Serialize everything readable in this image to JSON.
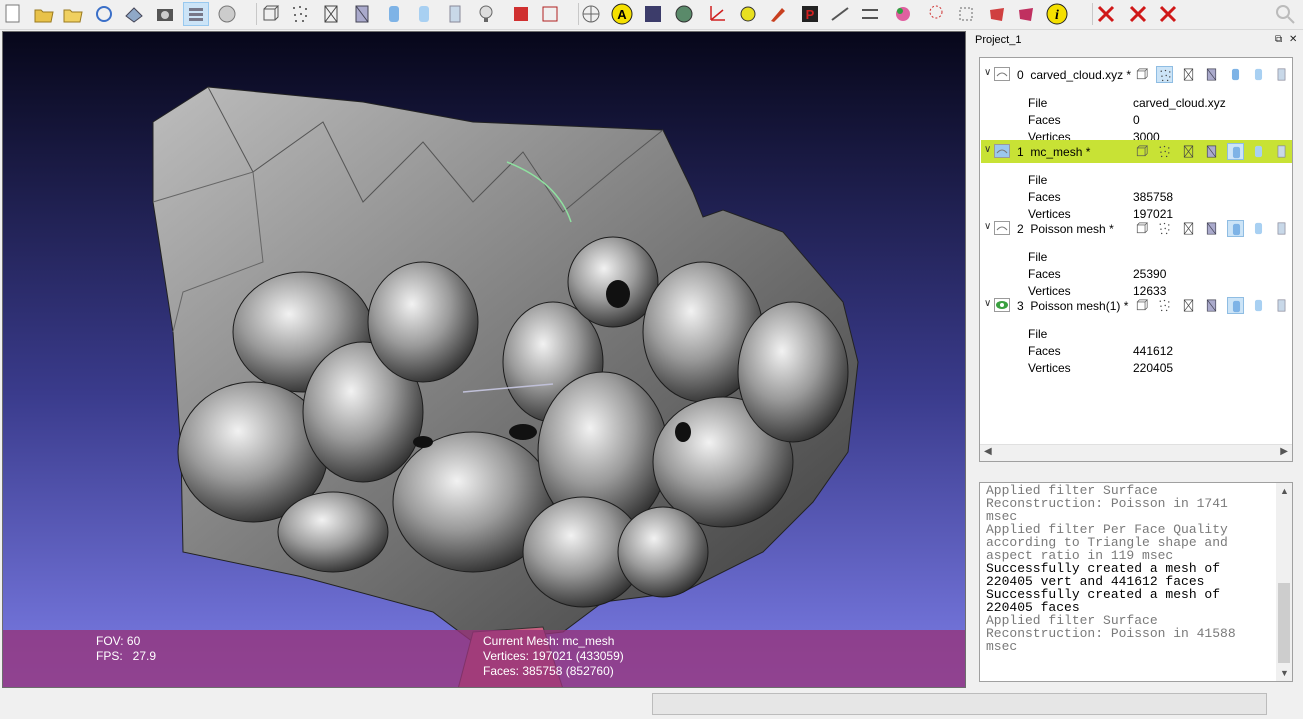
{
  "toolbar": {
    "buttons": [
      {
        "icon": "new-project-icon"
      },
      {
        "icon": "open-project-icon"
      },
      {
        "icon": "import-mesh-icon"
      },
      {
        "icon": "reload-icon"
      },
      {
        "icon": "save-snapshot-icon"
      },
      {
        "icon": "camera-icon"
      },
      {
        "icon": "layers-icon",
        "active": true
      },
      {
        "icon": "raster-layers-icon"
      },
      {
        "icon": "bounding-box-icon"
      },
      {
        "icon": "points-icon"
      },
      {
        "icon": "wireframe-icon"
      },
      {
        "icon": "hidden-lines-icon"
      },
      {
        "icon": "flat-shading-icon"
      },
      {
        "icon": "smooth-shading-icon"
      },
      {
        "icon": "texture-icon"
      },
      {
        "icon": "light-icon"
      },
      {
        "icon": "fancy-lighting-icon"
      },
      {
        "icon": "back-face-icon"
      },
      {
        "icon": "trackball-icon"
      },
      {
        "icon": "annotation-icon"
      },
      {
        "icon": "ambient-occlusion-icon"
      },
      {
        "icon": "sphere-render-icon"
      },
      {
        "icon": "axes-icon"
      },
      {
        "icon": "color-icon"
      },
      {
        "icon": "paint-brush-icon"
      },
      {
        "icon": "pick-points-icon"
      },
      {
        "icon": "measure-icon"
      },
      {
        "icon": "align-icon"
      },
      {
        "icon": "select-vertices-icon"
      },
      {
        "icon": "reference-icon"
      },
      {
        "icon": "select-faces-icon"
      },
      {
        "icon": "select-region-icon"
      },
      {
        "icon": "select-connected-icon"
      },
      {
        "icon": "info-icon"
      },
      {
        "icon": "delete-faces-icon"
      },
      {
        "icon": "delete-vertices-icon"
      },
      {
        "icon": "delete-all-icon"
      }
    ]
  },
  "viewport": {
    "fov_label": "FOV: 60",
    "fps_label": "FPS:   27.9",
    "current_mesh": "Current Mesh: mc_mesh",
    "vertices": "Vertices: 197021 (433059)",
    "faces": "Faces: 385758 (852760)"
  },
  "project": {
    "title": "Project_1",
    "layers": [
      {
        "index": "0",
        "name": "carved_cloud.xyz *",
        "file": "carved_cloud.xyz",
        "faces": "0",
        "vertices": "3000",
        "selected": false,
        "vis_icon": "layer-visible-icon"
      },
      {
        "index": "1",
        "name": "mc_mesh *",
        "file": "",
        "faces": "385758",
        "vertices": "197021",
        "selected": true,
        "vis_icon": "layer-visible-icon"
      },
      {
        "index": "2",
        "name": "Poisson mesh *",
        "file": "",
        "faces": "25390",
        "vertices": "12633",
        "selected": false,
        "vis_icon": "layer-visible-icon"
      },
      {
        "index": "3",
        "name": "Poisson mesh(1) *",
        "file": "",
        "faces": "441612",
        "vertices": "220405",
        "selected": false,
        "vis_icon": "eye-icon"
      }
    ],
    "labels": {
      "file": "File",
      "faces": "Faces",
      "vertices": "Vertices"
    }
  },
  "log": [
    {
      "text": "Applied filter Surface",
      "gray": true
    },
    {
      "text": "Reconstruction: Poisson in 1741",
      "gray": true
    },
    {
      "text": "msec",
      "gray": true
    },
    {
      "text": "Applied filter Per Face Quality",
      "gray": true
    },
    {
      "text": "according to Triangle shape and",
      "gray": true
    },
    {
      "text": "aspect ratio in 119 msec",
      "gray": true
    },
    {
      "text": "Successfully created a mesh of",
      "gray": false
    },
    {
      "text": "220405 vert and 441612 faces",
      "gray": false
    },
    {
      "text": "Successfully created a mesh of",
      "gray": false
    },
    {
      "text": "220405 faces",
      "gray": false
    },
    {
      "text": "Applied filter Surface",
      "gray": true
    },
    {
      "text": "Reconstruction: Poisson in 41588",
      "gray": true
    },
    {
      "text": "msec",
      "gray": true
    }
  ],
  "colors": {
    "viewport_top": "#07071a",
    "viewport_bottom": "#7d7ee8",
    "selected_row": "#c8e235",
    "hud": "#963278"
  }
}
